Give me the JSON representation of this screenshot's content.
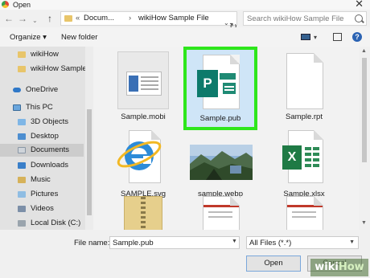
{
  "window": {
    "title": "Open",
    "close_glyph": "✕"
  },
  "address": {
    "back": "←",
    "forward": "→",
    "recent": "⌄",
    "up": "↑",
    "sep": "«",
    "crumb_1": "Docum...",
    "crumb_sep": "›",
    "crumb_2": "wikiHow Sample File",
    "dropdown": "⌄",
    "refresh": "↻"
  },
  "search": {
    "placeholder": "Search wikiHow Sample File",
    "icon": "search-icon"
  },
  "toolbar": {
    "organize_label": "Organize ▾",
    "new_folder_label": "New folder",
    "view_dropdown": "▾",
    "help_label": "?"
  },
  "navpane": {
    "items": [
      {
        "label": "wikiHow",
        "icon": "folder-icon"
      },
      {
        "label": "wikiHow Sample",
        "icon": "folder-icon"
      },
      {
        "label": "OneDrive",
        "icon": "cloud-icon"
      },
      {
        "label": "This PC",
        "icon": "computer-icon"
      },
      {
        "label": "3D Objects",
        "icon": "3d-objects-icon"
      },
      {
        "label": "Desktop",
        "icon": "desktop-icon"
      },
      {
        "label": "Documents",
        "icon": "documents-icon"
      },
      {
        "label": "Downloads",
        "icon": "downloads-icon"
      },
      {
        "label": "Music",
        "icon": "music-icon"
      },
      {
        "label": "Pictures",
        "icon": "pictures-icon"
      },
      {
        "label": "Videos",
        "icon": "videos-icon"
      },
      {
        "label": "Local Disk (C:)",
        "icon": "disk-icon"
      }
    ],
    "selected": "Documents"
  },
  "files": [
    {
      "name": "Sample.mobi",
      "icon": "mobi-file-icon"
    },
    {
      "name": "Sample.pub",
      "icon": "publisher-icon",
      "highlight_color": "#2ee61c"
    },
    {
      "name": "Sample.rpt",
      "icon": "blank-file-icon"
    },
    {
      "name": "SAMPLE.svg",
      "icon": "internet-explorer-icon"
    },
    {
      "name": "sample.webp",
      "icon": "landscape-thumbnail"
    },
    {
      "name": "Sample.xlsx",
      "icon": "excel-icon"
    },
    {
      "name": "",
      "icon": "zip-file-icon"
    },
    {
      "name": "",
      "icon": "document-file-icon"
    },
    {
      "name": "",
      "icon": "document-file-icon"
    }
  ],
  "publisher_letter": "P",
  "excel_letter": "X",
  "bottom": {
    "filename_label": "File name:",
    "filename_value": "Sample.pub",
    "filter_value": "All Files (*.*)",
    "open_label": "Open",
    "cancel_label": "Cancel"
  },
  "watermark": {
    "prefix": "wiki",
    "suffix": "How"
  },
  "colors": {
    "accent": "#2b63b3",
    "highlight": "#2ee61c",
    "selection": "#cfe5f7"
  }
}
